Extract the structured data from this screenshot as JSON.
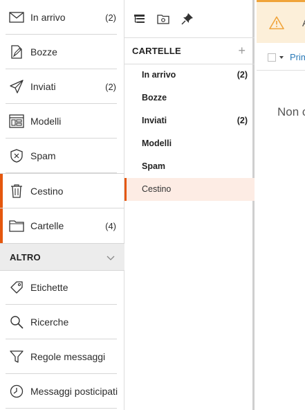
{
  "nav": {
    "items": [
      {
        "label": "In arrivo",
        "count": "(2)",
        "icon": "envelope-icon"
      },
      {
        "label": "Bozze",
        "count": "",
        "icon": "draft-icon"
      },
      {
        "label": "Inviati",
        "count": "(2)",
        "icon": "send-icon"
      },
      {
        "label": "Modelli",
        "count": "",
        "icon": "template-icon"
      },
      {
        "label": "Spam",
        "count": "",
        "icon": "spam-shield-icon"
      },
      {
        "label": "Cestino",
        "count": "",
        "icon": "trash-icon"
      },
      {
        "label": "Cartelle",
        "count": "(4)",
        "icon": "folder-icon"
      }
    ],
    "altro": {
      "label": "ALTRO"
    },
    "extra_items": [
      {
        "label": "Etichette",
        "icon": "tag-icon"
      },
      {
        "label": "Ricerche",
        "icon": "search-icon"
      },
      {
        "label": "Regole messaggi",
        "icon": "filter-icon"
      },
      {
        "label": "Messaggi posticipati",
        "icon": "clock-icon"
      }
    ]
  },
  "folders": {
    "toolbar_icons": [
      "folder-tree-icon",
      "new-folder-icon",
      "pin-icon"
    ],
    "header": "CARTELLE",
    "add_symbol": "+",
    "items": [
      {
        "label": "In arrivo",
        "count": "(2)"
      },
      {
        "label": "Bozze",
        "count": ""
      },
      {
        "label": "Inviati",
        "count": "(2)"
      },
      {
        "label": "Modelli",
        "count": ""
      },
      {
        "label": "Spam",
        "count": ""
      },
      {
        "label": "Cestino",
        "count": ""
      }
    ],
    "selected": "Cestino"
  },
  "main": {
    "banner_text": "A",
    "list_first_option": "Prim",
    "empty_text": "Non c"
  },
  "colors": {
    "accent": "#e5570e",
    "selected_bg": "#fdece4",
    "warning_bg": "#fcefd9",
    "warning_icon": "#f0a43a",
    "link": "#2a7ab8"
  }
}
